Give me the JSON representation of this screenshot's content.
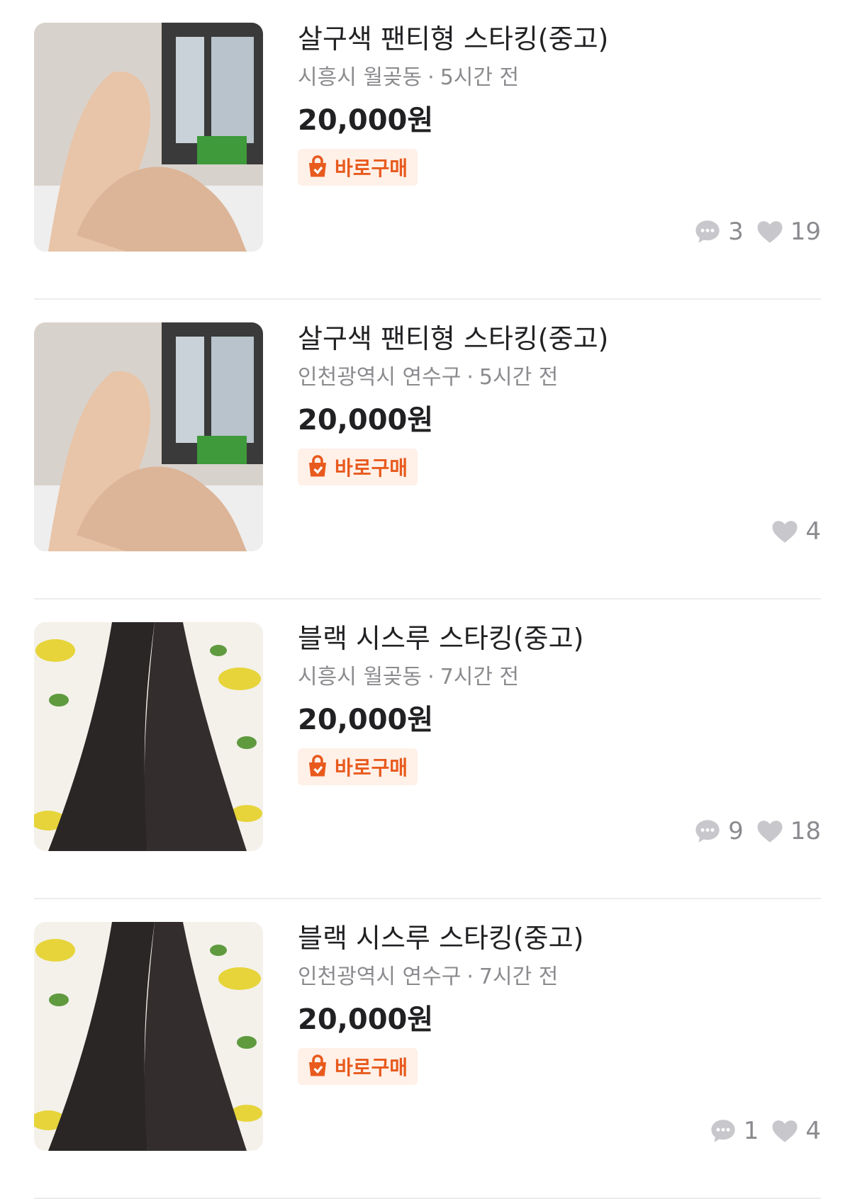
{
  "items": [
    {
      "title": "살구색 팬티형 스타킹(중고)",
      "location": "시흥시 월곶동",
      "time": "5시간 전",
      "price": "20,000원",
      "badge": "바로구매",
      "chats": "3",
      "likes": "19",
      "photo": "beige-stockings"
    },
    {
      "title": "살구색 팬티형 스타킹(중고)",
      "location": "인천광역시 연수구",
      "time": "5시간 전",
      "price": "20,000원",
      "badge": "바로구매",
      "chats": "",
      "likes": "4",
      "photo": "beige-stockings"
    },
    {
      "title": "블랙 시스루 스타킹(중고)",
      "location": "시흥시 월곶동",
      "time": "7시간 전",
      "price": "20,000원",
      "badge": "바로구매",
      "chats": "9",
      "likes": "18",
      "photo": "black-stockings"
    },
    {
      "title": "블랙 시스루 스타킹(중고)",
      "location": "인천광역시 연수구",
      "time": "7시간 전",
      "price": "20,000원",
      "badge": "바로구매",
      "chats": "1",
      "likes": "4",
      "photo": "black-stockings"
    }
  ],
  "colors": {
    "badge_text": "#e85a1d",
    "badge_bg": "#fff0e8",
    "meta_text": "#8b8b8f"
  },
  "icons": {
    "badge": "shopping-bag-icon",
    "chat": "chat-bubble-icon",
    "like": "heart-icon"
  }
}
